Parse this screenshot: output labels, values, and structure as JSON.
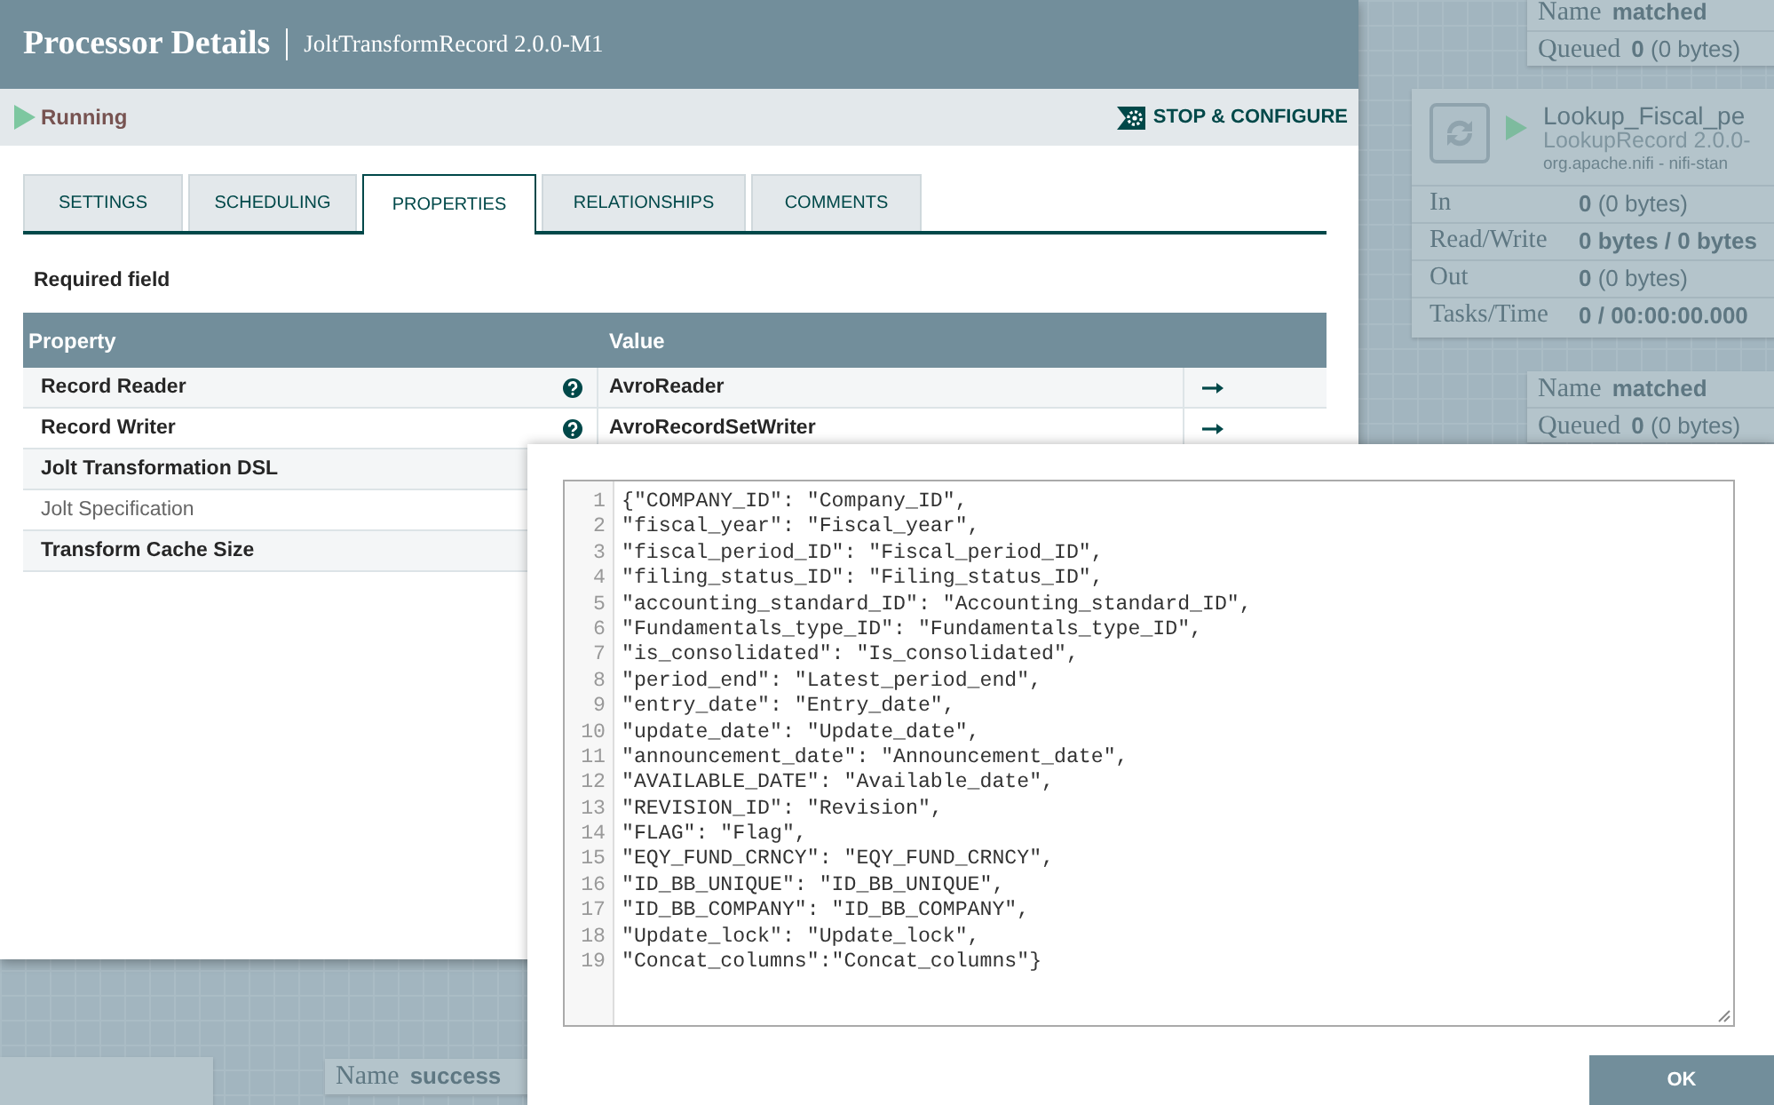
{
  "canvas": {
    "connections": [
      {
        "name_label": "Name",
        "name": "matched",
        "queued_label": "Queued",
        "queued_count": "0",
        "queued_bytes": "(0 bytes)"
      },
      {
        "name_label": "Name",
        "name": "matched",
        "queued_label": "Queued",
        "queued_count": "0",
        "queued_bytes": "(0 bytes)"
      },
      {
        "name_label": "Name",
        "name": "success"
      }
    ],
    "processor": {
      "name": "Lookup_Fiscal_pe",
      "type": "LookupRecord 2.0.0-",
      "bundle": "org.apache.nifi - nifi-stan",
      "running": true,
      "stats": [
        {
          "label": "In",
          "value": "0",
          "detail": "(0 bytes)"
        },
        {
          "label": "Read/Write",
          "value": "0 bytes / 0 bytes"
        },
        {
          "label": "Out",
          "value": "0",
          "detail": "(0 bytes)"
        },
        {
          "label": "Tasks/Time",
          "value": "0 / 00:00:00.000"
        }
      ]
    }
  },
  "dialog": {
    "title": "Processor Details",
    "subtitle": "JoltTransformRecord 2.0.0-M1",
    "status": {
      "running": true,
      "label": "Running"
    },
    "action": "STOP & CONFIGURE",
    "tabs": [
      {
        "label": "SETTINGS",
        "selected": false
      },
      {
        "label": "SCHEDULING",
        "selected": false
      },
      {
        "label": "PROPERTIES",
        "selected": true
      },
      {
        "label": "RELATIONSHIPS",
        "selected": false
      },
      {
        "label": "COMMENTS",
        "selected": false
      }
    ],
    "required_note": "Required field",
    "table": {
      "columns": [
        "Property",
        "Value"
      ],
      "rows": [
        {
          "property": "Record Reader",
          "required": true,
          "help": true,
          "value": "AvroReader",
          "go_to": true
        },
        {
          "property": "Record Writer",
          "required": true,
          "help": true,
          "value": "AvroRecordSetWriter",
          "go_to": true
        },
        {
          "property": "Jolt Transformation DSL",
          "required": true,
          "help": false
        },
        {
          "property": "Jolt Specification",
          "required": false,
          "help": false
        },
        {
          "property": "Transform Cache Size",
          "required": true,
          "help": false
        }
      ]
    }
  },
  "editor": {
    "lines": [
      {
        "number": "1",
        "text": "{\"COMPANY_ID\": \"Company_ID\","
      },
      {
        "number": "2",
        "text": "\"fiscal_year\": \"Fiscal_year\","
      },
      {
        "number": "3",
        "text": "\"fiscal_period_ID\": \"Fiscal_period_ID\","
      },
      {
        "number": "4",
        "text": "\"filing_status_ID\": \"Filing_status_ID\","
      },
      {
        "number": "5",
        "text": "\"accounting_standard_ID\": \"Accounting_standard_ID\","
      },
      {
        "number": "6",
        "text": "\"Fundamentals_type_ID\": \"Fundamentals_type_ID\","
      },
      {
        "number": "7",
        "text": "\"is_consolidated\": \"Is_consolidated\","
      },
      {
        "number": "8",
        "text": "\"period_end\": \"Latest_period_end\","
      },
      {
        "number": "9",
        "text": "\"entry_date\": \"Entry_date\","
      },
      {
        "number": "10",
        "text": "\"update_date\": \"Update_date\","
      },
      {
        "number": "11",
        "text": "\"announcement_date\": \"Announcement_date\","
      },
      {
        "number": "12",
        "text": "\"AVAILABLE_DATE\": \"Available_date\","
      },
      {
        "number": "13",
        "text": "\"REVISION_ID\": \"Revision\","
      },
      {
        "number": "14",
        "text": "\"FLAG\": \"Flag\","
      },
      {
        "number": "15",
        "text": "\"EQY_FUND_CRNCY\": \"EQY_FUND_CRNCY\","
      },
      {
        "number": "16",
        "text": "\"ID_BB_UNIQUE\": \"ID_BB_UNIQUE\","
      },
      {
        "number": "17",
        "text": "\"ID_BB_COMPANY\": \"ID_BB_COMPANY\","
      },
      {
        "number": "18",
        "text": "\"Update_lock\": \"Update_lock\","
      },
      {
        "number": "19",
        "text": "\"Concat_columns\":\"Concat_columns\"}"
      }
    ],
    "button": "OK"
  }
}
